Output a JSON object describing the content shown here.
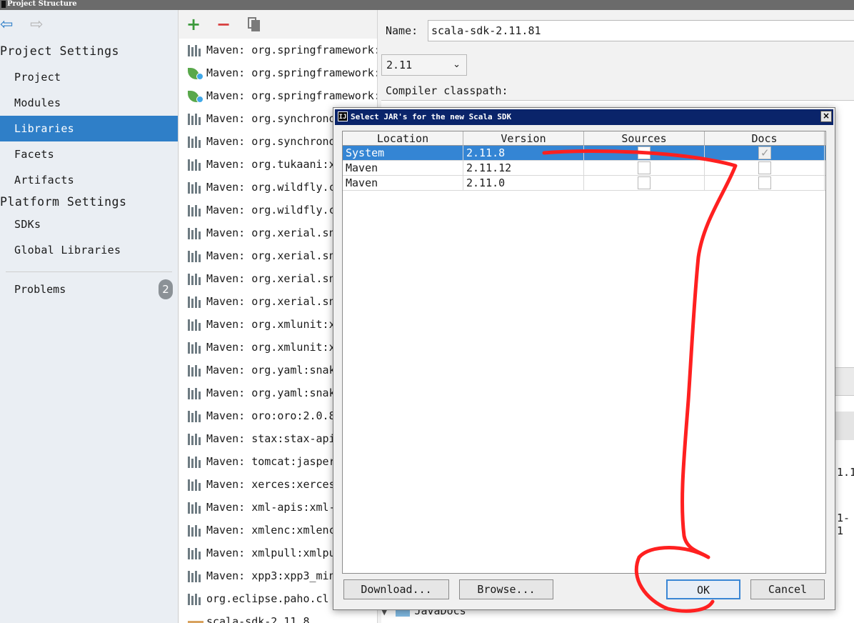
{
  "window": {
    "title": "Project Structure"
  },
  "colors": {
    "selection": "#2f7fc8",
    "dialog_title": "#0a246a",
    "annotation": "#ff2020",
    "add": "#3c9a3c",
    "remove": "#d84040"
  },
  "icons": {
    "back": "arrow-left-icon",
    "forward": "arrow-right-icon",
    "add": "plus-icon",
    "remove": "minus-icon",
    "copy": "copy-icon"
  },
  "sidebar": {
    "project_settings": "Project Settings",
    "project_items": [
      "Project",
      "Modules",
      "Libraries",
      "Facets",
      "Artifacts"
    ],
    "selected": "Libraries",
    "platform_settings": "Platform Settings",
    "platform_items": [
      "SDKs",
      "Global Libraries"
    ],
    "problems": {
      "label": "Problems",
      "count": "2"
    }
  },
  "libraries": {
    "toolbar": {
      "add": "+",
      "remove": "−"
    },
    "items": [
      {
        "icon": "maven",
        "label": "Maven: org.springframework:"
      },
      {
        "icon": "spring",
        "label": "Maven: org.springframework:"
      },
      {
        "icon": "spring",
        "label": "Maven: org.springframework:"
      },
      {
        "icon": "maven",
        "label": "Maven: org.synchrono"
      },
      {
        "icon": "maven",
        "label": "Maven: org.synchrono"
      },
      {
        "icon": "maven",
        "label": "Maven: org.tukaani:x"
      },
      {
        "icon": "maven",
        "label": "Maven: org.wildfly.c"
      },
      {
        "icon": "maven",
        "label": "Maven: org.wildfly.c"
      },
      {
        "icon": "maven",
        "label": "Maven: org.xerial.sn"
      },
      {
        "icon": "maven",
        "label": "Maven: org.xerial.sn"
      },
      {
        "icon": "maven",
        "label": "Maven: org.xerial.sn"
      },
      {
        "icon": "maven",
        "label": "Maven: org.xerial.sn"
      },
      {
        "icon": "maven",
        "label": "Maven: org.xmlunit:x"
      },
      {
        "icon": "maven",
        "label": "Maven: org.xmlunit:x"
      },
      {
        "icon": "maven",
        "label": "Maven: org.yaml:snak"
      },
      {
        "icon": "maven",
        "label": "Maven: org.yaml:snak"
      },
      {
        "icon": "maven",
        "label": "Maven: oro:oro:2.0.8"
      },
      {
        "icon": "maven",
        "label": "Maven: stax:stax-api"
      },
      {
        "icon": "maven",
        "label": "Maven: tomcat:jasper"
      },
      {
        "icon": "maven",
        "label": "Maven: xerces:xerces"
      },
      {
        "icon": "maven",
        "label": "Maven: xml-apis:xml-"
      },
      {
        "icon": "maven",
        "label": "Maven: xmlenc:xmlenc"
      },
      {
        "icon": "maven",
        "label": "Maven: xmlpull:xmlpu"
      },
      {
        "icon": "maven",
        "label": "Maven: xpp3:xpp3_min"
      },
      {
        "icon": "maven",
        "label": "org.eclipse.paho.cl"
      },
      {
        "icon": "folder",
        "label": "scala-sdk-2.11.8"
      }
    ]
  },
  "detail": {
    "name_label": "Name:",
    "name_value": "scala-sdk-2.11.81",
    "version_selected": "2.11",
    "compiler_classpath_label": "Compiler classpath:",
    "peek_text_1": "1.1",
    "peek_text_2": "1-1",
    "javadocs_label": "JavaDocs"
  },
  "dialog": {
    "title": "Select JAR's for the new Scala SDK",
    "close": "×",
    "columns": [
      "Location",
      "Version",
      "Sources",
      "Docs"
    ],
    "rows": [
      {
        "location": "System",
        "version": "2.11.8",
        "sources": false,
        "docs": true,
        "selected": true
      },
      {
        "location": "Maven",
        "version": "2.11.12",
        "sources": false,
        "docs": false,
        "selected": false
      },
      {
        "location": "Maven",
        "version": "2.11.0",
        "sources": false,
        "docs": false,
        "selected": false
      }
    ],
    "buttons": {
      "download": "Download...",
      "browse": "Browse...",
      "ok": "OK",
      "cancel": "Cancel"
    }
  }
}
